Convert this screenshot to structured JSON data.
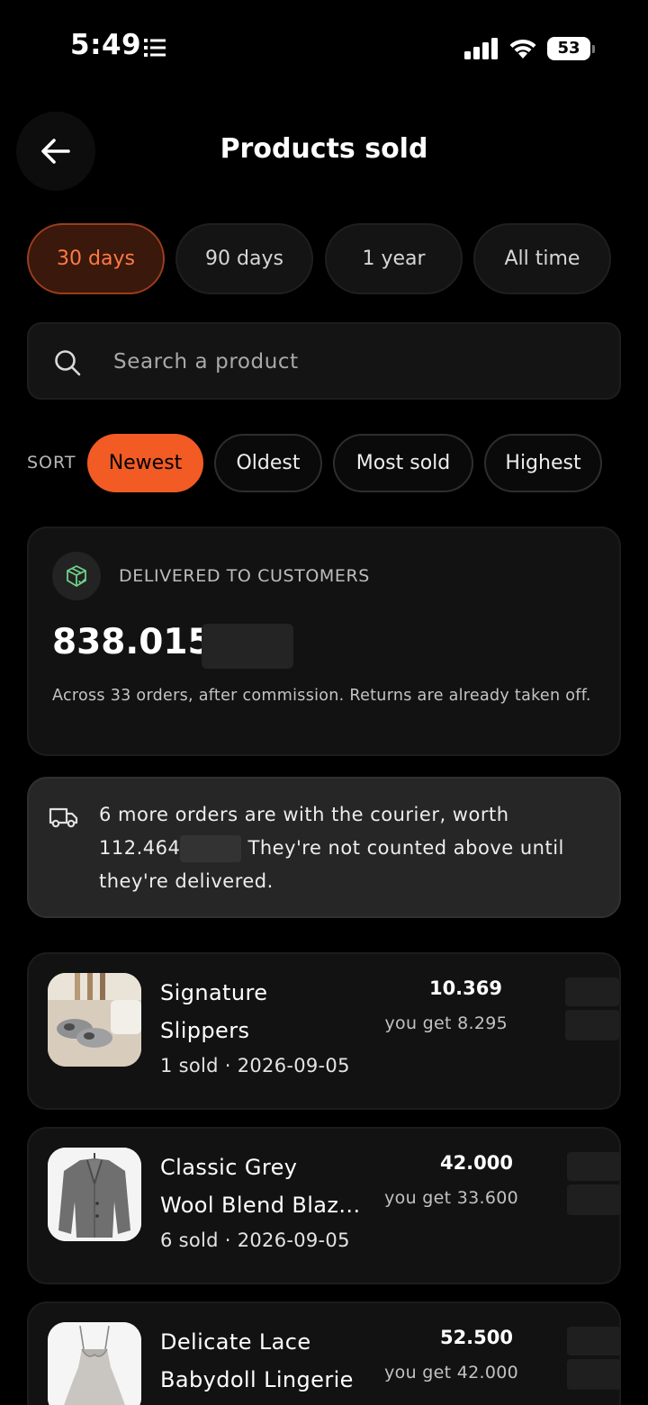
{
  "status_bar": {
    "time": "5:49",
    "battery": "53"
  },
  "header": {
    "title": "Products sold",
    "back_icon": "arrow-left-icon"
  },
  "period_filters": [
    {
      "label": "30 days",
      "active": true
    },
    {
      "label": "90 days",
      "active": false
    },
    {
      "label": "1 year",
      "active": false
    },
    {
      "label": "All time",
      "active": false
    }
  ],
  "search": {
    "placeholder": "Search a product",
    "value": ""
  },
  "sort": {
    "label": "SORT",
    "options": [
      {
        "label": "Newest",
        "active": true
      },
      {
        "label": "Oldest",
        "active": false
      },
      {
        "label": "Most sold",
        "active": false
      },
      {
        "label": "Highest",
        "active": false
      }
    ]
  },
  "delivered": {
    "label": "DELIVERED TO CUSTOMERS",
    "amount": "838.015",
    "note": "Across 33 orders, after commission. Returns are already taken off."
  },
  "courier": {
    "line1": "6 more orders are with the courier, worth",
    "amount": "112.464",
    "line2": "They're not counted above until they're delivered."
  },
  "products": [
    {
      "name_line1": "Signature",
      "name_line2": "Slippers",
      "meta": "1 sold · 2026-09-05",
      "price": "10.369",
      "you_get": "you get 8.295",
      "image": "slippers"
    },
    {
      "name_line1": "Classic Grey",
      "name_line2": "Wool Blend Blaz...",
      "meta": "6 sold · 2026-09-05",
      "price": "42.000",
      "you_get": "you get 33.600",
      "image": "coat"
    },
    {
      "name_line1": "Delicate Lace",
      "name_line2": "Babydoll Lingerie",
      "meta": "",
      "price": "52.500",
      "you_get": "you get 42.000",
      "image": "lingerie"
    }
  ],
  "colors": {
    "accent": "#f25b24",
    "accent_dark": "#3a180c",
    "card": "#121212",
    "notice": "#262626",
    "success_icon": "#6fd08a"
  }
}
